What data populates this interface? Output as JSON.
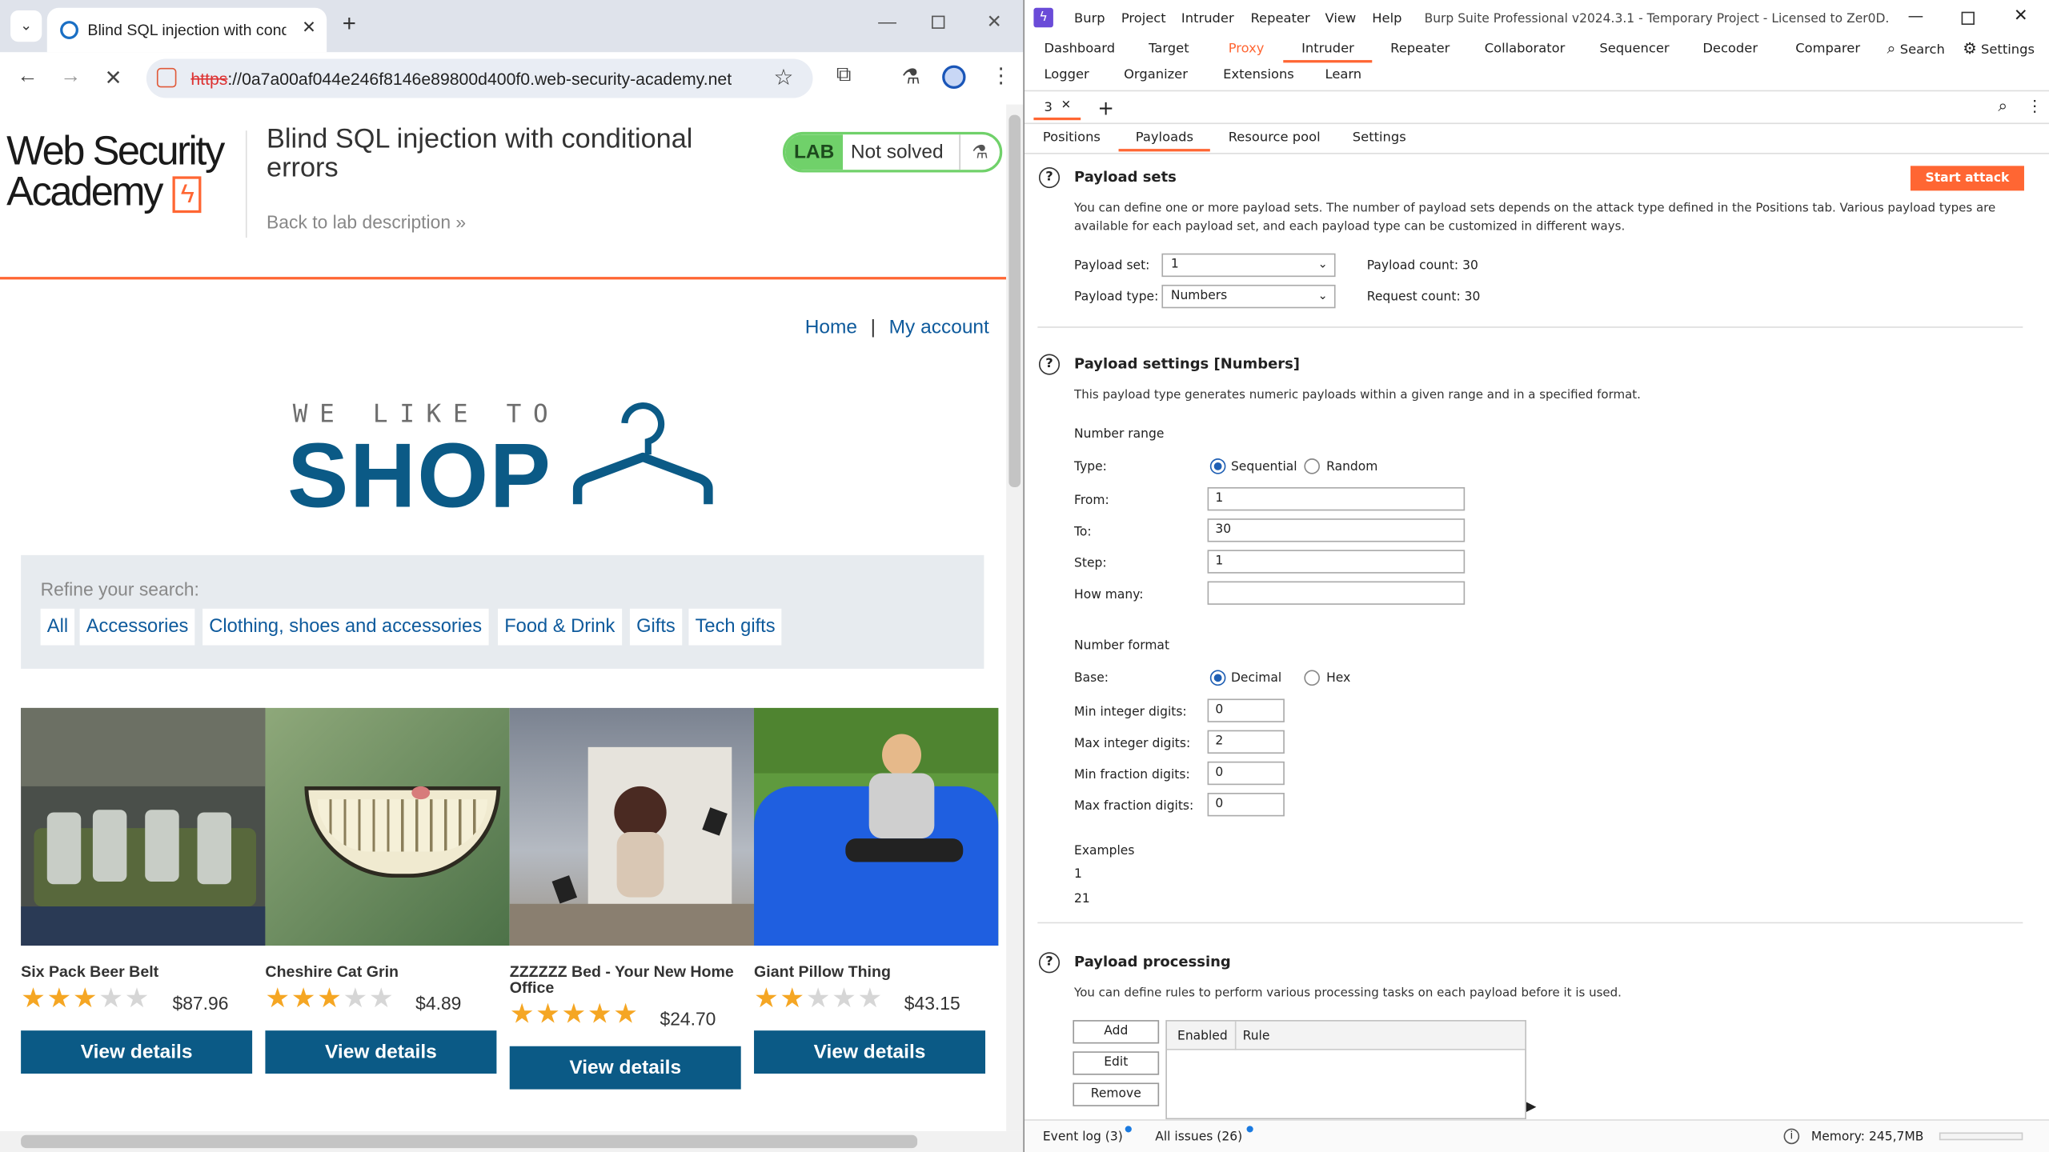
{
  "browser": {
    "tab_title": "Blind SQL injection with conditi",
    "url_scheme": "https",
    "url_rest": "://0a7a00af044e246f8146e89800d400f0.web-security-academy.net"
  },
  "lab": {
    "logo_line1": "Web Security",
    "logo_line2": "Academy",
    "title": "Blind SQL injection with conditional errors",
    "back_link": "Back to lab description",
    "badge_lab": "LAB",
    "badge_status": "Not solved"
  },
  "shop": {
    "nav_home": "Home",
    "nav_sep": "|",
    "nav_account": "My account",
    "banner_sub": "WE LIKE TO",
    "banner_main": "SHOP",
    "refine_label": "Refine your search:",
    "categories": [
      "All",
      "Accessories",
      "Clothing, shoes and accessories",
      "Food & Drink",
      "Gifts",
      "Tech gifts"
    ],
    "products": [
      {
        "name": "Six Pack Beer Belt",
        "rating": 3,
        "price": "$87.96",
        "button": "View details"
      },
      {
        "name": "Cheshire Cat Grin",
        "rating": 3,
        "price": "$4.89",
        "button": "View details"
      },
      {
        "name": "ZZZZZZ Bed - Your New Home Office",
        "rating": 5,
        "price": "$24.70",
        "button": "View details"
      },
      {
        "name": "Giant Pillow Thing",
        "rating": 2,
        "price": "$43.15",
        "button": "View details"
      }
    ]
  },
  "burp": {
    "menu": [
      "Burp",
      "Project",
      "Intruder",
      "Repeater",
      "View",
      "Help"
    ],
    "window_title": "Burp Suite Professional v2024.3.1 - Temporary Project - Licensed to Zer0D...",
    "tabs_row1": [
      "Dashboard",
      "Target",
      "Proxy",
      "Intruder",
      "Repeater",
      "Collaborator",
      "Sequencer",
      "Decoder",
      "Comparer"
    ],
    "tabs_row2": [
      "Logger",
      "Organizer",
      "Extensions",
      "Learn"
    ],
    "search": "Search",
    "settings": "Settings",
    "attack_tab": "3",
    "subtabs": [
      "Positions",
      "Payloads",
      "Resource pool",
      "Settings"
    ],
    "payload_sets": {
      "title": "Payload sets",
      "start_button": "Start attack",
      "description": "You can define one or more payload sets. The number of payload sets depends on the attack type defined in the Positions tab. Various payload types are available for each payload set, and each payload type can be customized in different ways.",
      "set_label": "Payload set:",
      "set_value": "1",
      "type_label": "Payload type:",
      "type_value": "Numbers",
      "payload_count": "Payload count: 30",
      "request_count": "Request count: 30"
    },
    "payload_settings": {
      "title": "Payload settings [Numbers]",
      "description": "This payload type generates numeric payloads within a given range and in a specified format.",
      "number_range": "Number range",
      "type_label": "Type:",
      "sequential": "Sequential",
      "random": "Random",
      "from_label": "From:",
      "from_value": "1",
      "to_label": "To:",
      "to_value": "30",
      "step_label": "Step:",
      "step_value": "1",
      "how_many_label": "How many:",
      "how_many_value": "",
      "number_format": "Number format",
      "base_label": "Base:",
      "decimal": "Decimal",
      "hex": "Hex",
      "min_int_label": "Min integer digits:",
      "min_int_value": "0",
      "max_int_label": "Max integer digits:",
      "max_int_value": "2",
      "min_frac_label": "Min fraction digits:",
      "min_frac_value": "0",
      "max_frac_label": "Max fraction digits:",
      "max_frac_value": "0",
      "examples_label": "Examples",
      "example1": "1",
      "example2": "21"
    },
    "payload_processing": {
      "title": "Payload processing",
      "description": "You can define rules to perform various processing tasks on each payload before it is used.",
      "add": "Add",
      "edit": "Edit",
      "remove": "Remove",
      "col_enabled": "Enabled",
      "col_rule": "Rule"
    },
    "status": {
      "event_log": "Event log (3)",
      "all_issues": "All issues (26)",
      "memory": "Memory: 245,7MB"
    },
    "colors": {
      "accent": "#ff6633",
      "selected_radio": "#1f5fb4"
    }
  }
}
